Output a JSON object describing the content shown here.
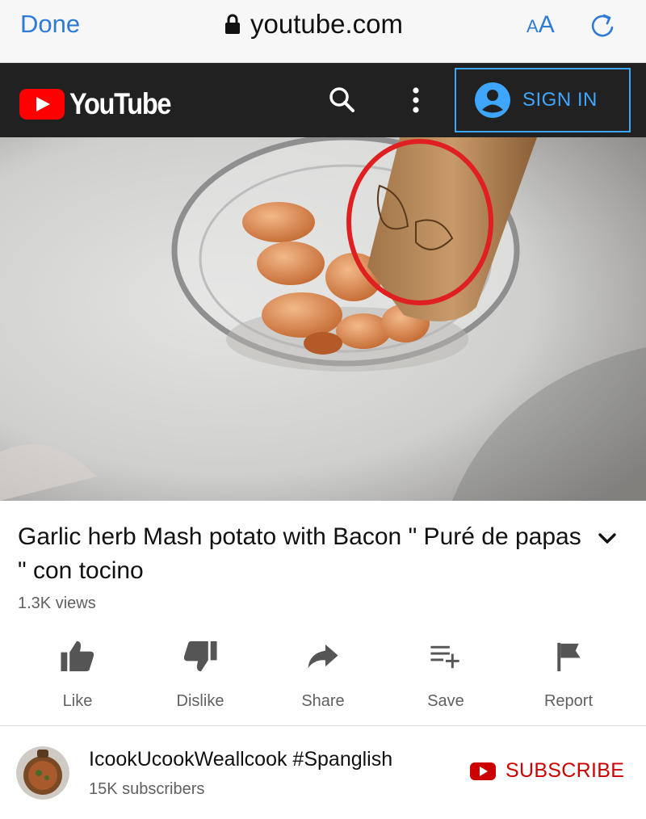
{
  "browser": {
    "done_label": "Done",
    "url": "youtube.com",
    "aa_small": "A",
    "aa_big": "A",
    "icons": [
      "lock-icon",
      "reload-icon"
    ]
  },
  "header": {
    "logo_text": "YouTube",
    "signin_label": "SIGN IN",
    "icons": [
      "search-icon",
      "more-vert-icon",
      "account-icon"
    ],
    "accent": "#3ea6ff",
    "brand": "#ff0000"
  },
  "video": {
    "title": "Garlic herb Mash potato with Bacon \" Puré de papas \" con tocino",
    "views": "1.3K views"
  },
  "actions": [
    {
      "label": "Like",
      "icon": "thumb-up-icon"
    },
    {
      "label": "Dislike",
      "icon": "thumb-down-icon"
    },
    {
      "label": "Share",
      "icon": "share-arrow-icon"
    },
    {
      "label": "Save",
      "icon": "playlist-add-icon"
    },
    {
      "label": "Report",
      "icon": "flag-icon"
    }
  ],
  "channel": {
    "name": "IcookUcookWeallcook #Spanglish",
    "subscribers": "15K subscribers",
    "subscribe_label": "SUBSCRIBE",
    "subscribe_color": "#cc0000"
  }
}
